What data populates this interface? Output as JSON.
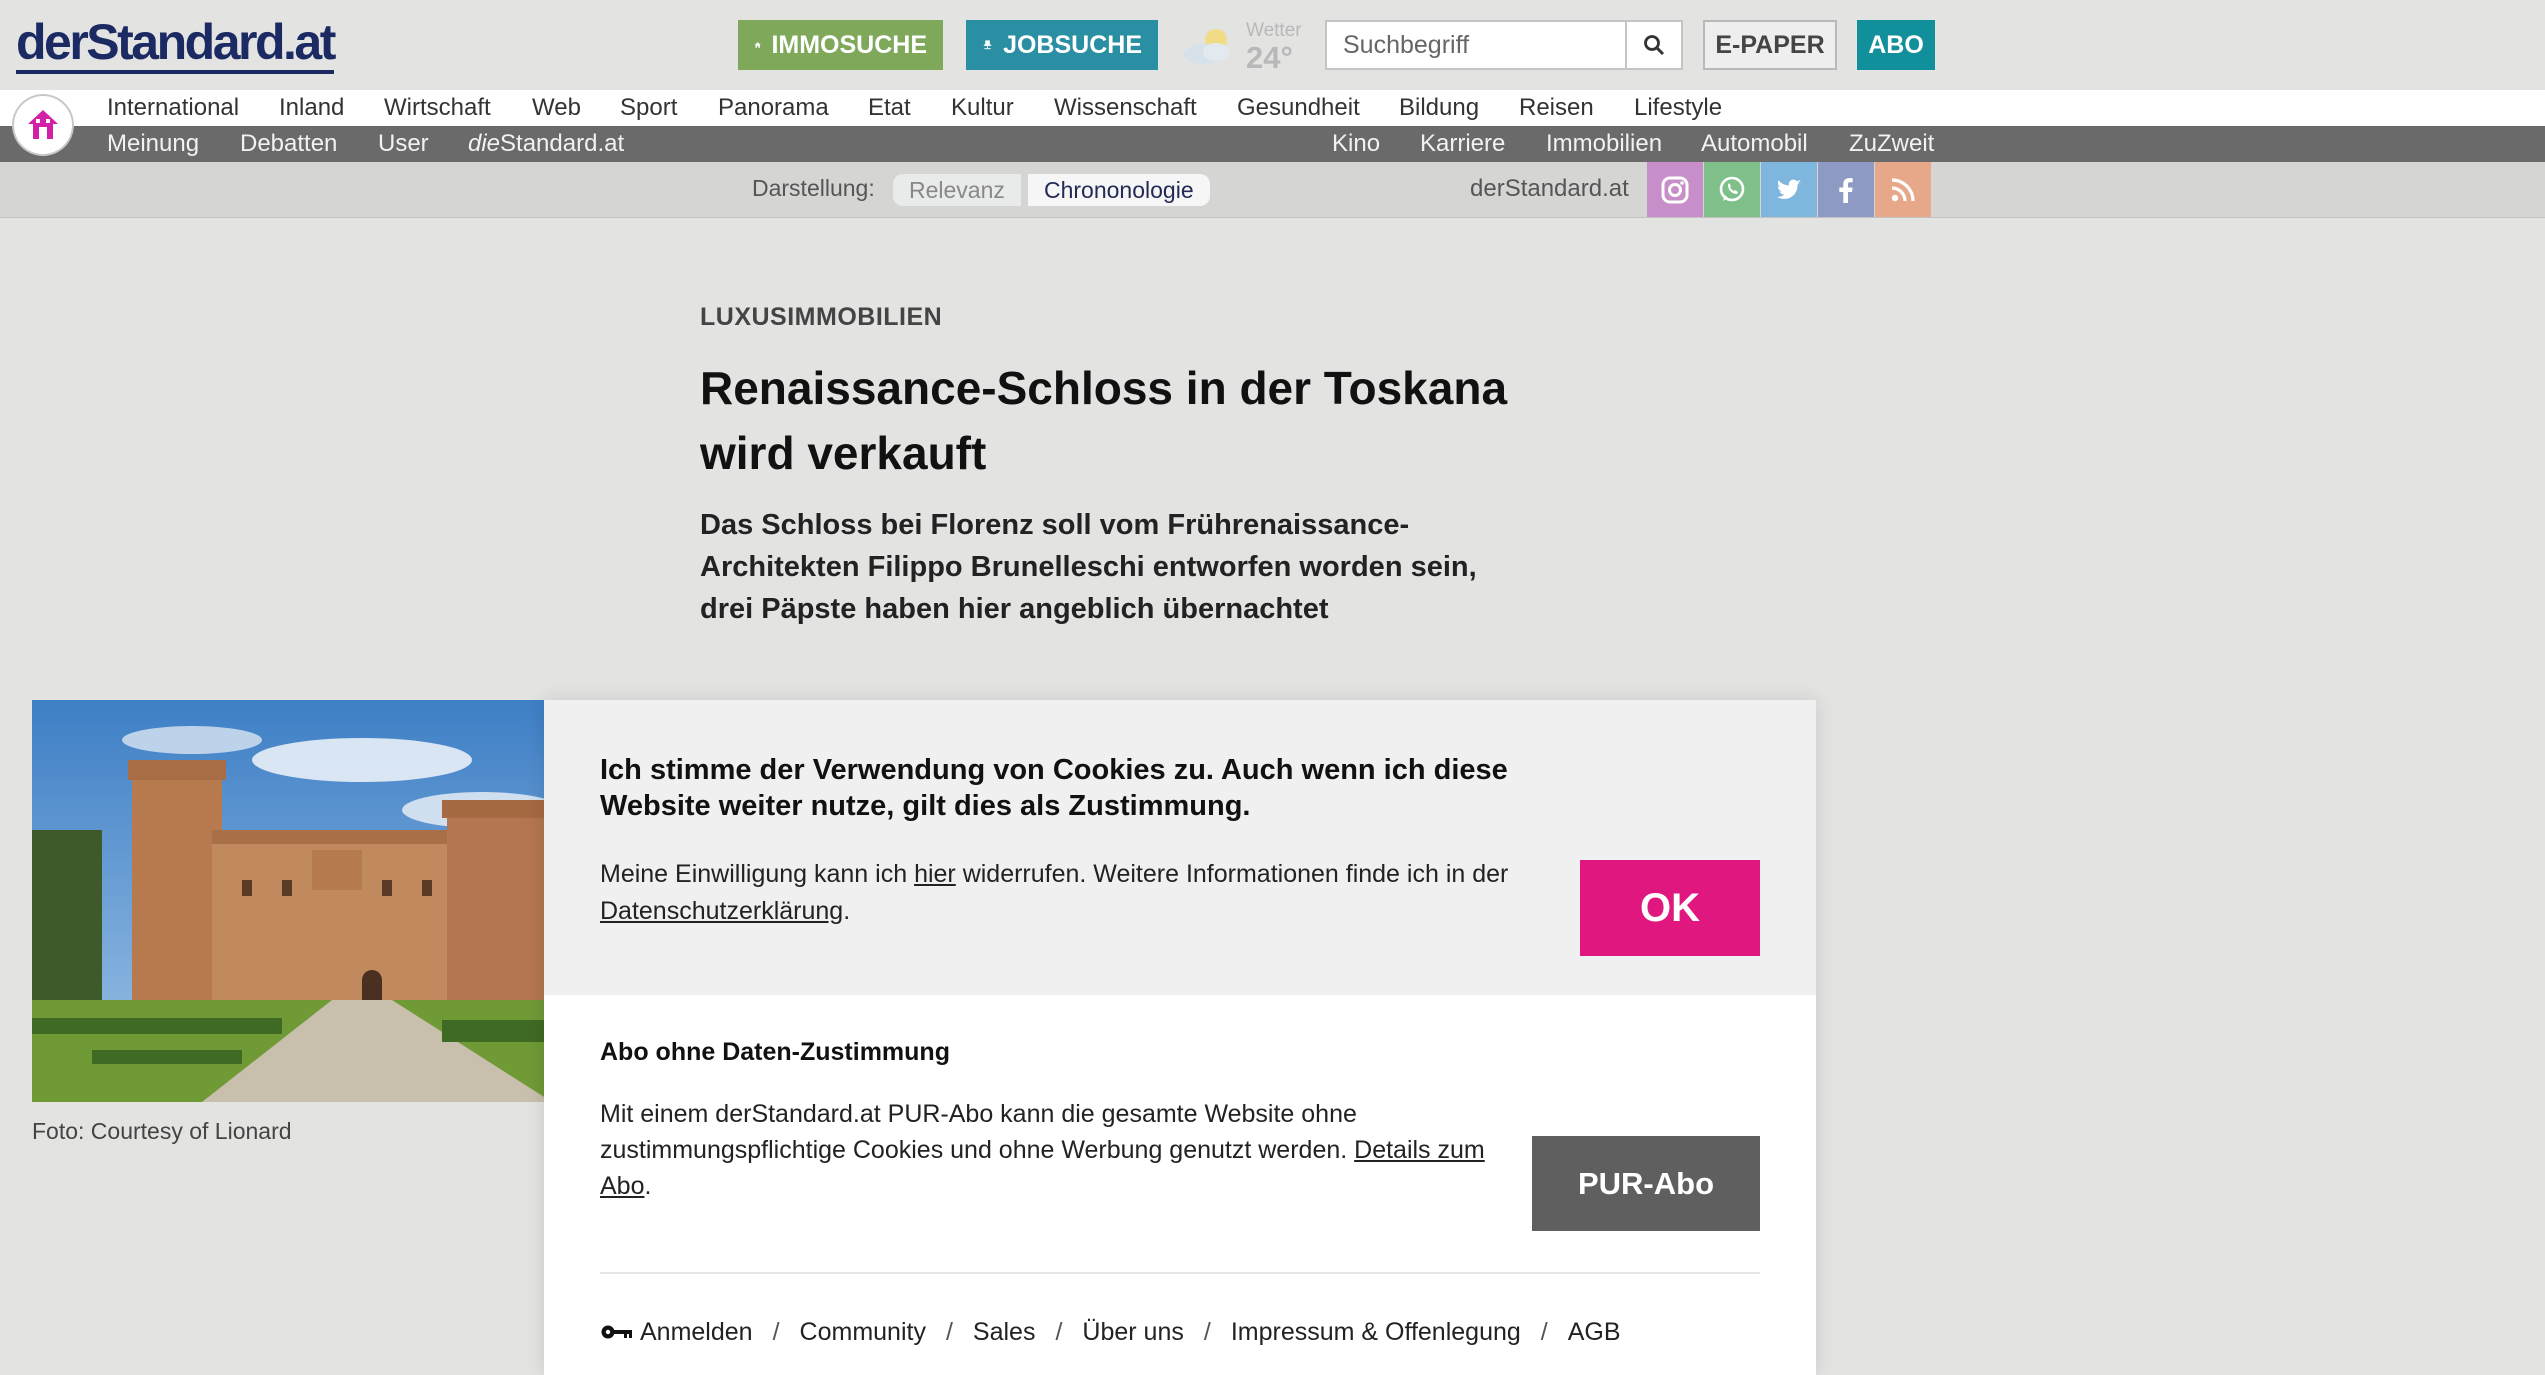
{
  "header": {
    "logo": "derStandard.at",
    "immosuche_label": "IMMOSUCHE",
    "jobsuche_label": "JOBSUCHE",
    "weather_label": "Wetter",
    "weather_temp": "24°",
    "search_placeholder": "Suchbegriff",
    "epaper_label": "E-PAPER",
    "abo_label": "ABO"
  },
  "nav": {
    "primary": [
      "International",
      "Inland",
      "Wirtschaft",
      "Web",
      "Sport",
      "Panorama",
      "Etat",
      "Kultur",
      "Wissenschaft",
      "Gesundheit",
      "Bildung",
      "Reisen",
      "Lifestyle"
    ],
    "secondary_left": [
      "Meinung",
      "Debatten",
      "User"
    ],
    "diestandard_prefix": "die",
    "diestandard_suffix": "Standard.at",
    "secondary_right": [
      "Kino",
      "Karriere",
      "Immobilien",
      "Automobil",
      "ZuZweit"
    ]
  },
  "display_bar": {
    "label": "Darstellung:",
    "option_relevanz": "Relevanz",
    "option_chronologie": "Chrononologie",
    "brand": "derStandard.at",
    "social": [
      {
        "name": "instagram-icon",
        "color": "#c88ec9"
      },
      {
        "name": "whatsapp-icon",
        "color": "#7fc08a"
      },
      {
        "name": "twitter-icon",
        "color": "#7fb6dd"
      },
      {
        "name": "facebook-icon",
        "color": "#8d9bc4"
      },
      {
        "name": "rss-icon",
        "color": "#e6a888"
      }
    ]
  },
  "article": {
    "kicker": "LUXUSIMMOBILIEN",
    "headline": "Renaissance-Schloss in der Toskana wird verkauft",
    "lede": "Das Schloss bei Florenz soll vom Frührenaissance-Architekten Filippo Brunelleschi entworfen worden sein, drei Päpste haben hier angeblich übernachtet",
    "photo_caption": "Foto: Courtesy of Lionard"
  },
  "cookie": {
    "title": "Ich stimme der Verwendung von Cookies zu. Auch wenn ich diese Website weiter nutze, gilt dies als Zustimmung.",
    "text_part1": "Meine Einwilligung kann ich ",
    "text_link1": "hier",
    "text_part2": " widerrufen. Weitere Informationen finde ich in der ",
    "text_link2": "Datenschutzerklärung",
    "text_part3": ".",
    "ok_label": "OK",
    "abo_title": "Abo ohne Daten-Zustimmung",
    "abo_text_part1": "Mit einem derStandard.at PUR-Abo kann die gesamte Website ohne zustimmungspflichtige Cookies und ohne Werbung genutzt werden. ",
    "abo_text_link": "Details zum Abo",
    "abo_text_part2": ".",
    "pur_label": "PUR-Abo",
    "footer_links": [
      "Anmelden",
      "Community",
      "Sales",
      "Über uns",
      "Impressum & Offenlegung",
      "AGB"
    ]
  }
}
